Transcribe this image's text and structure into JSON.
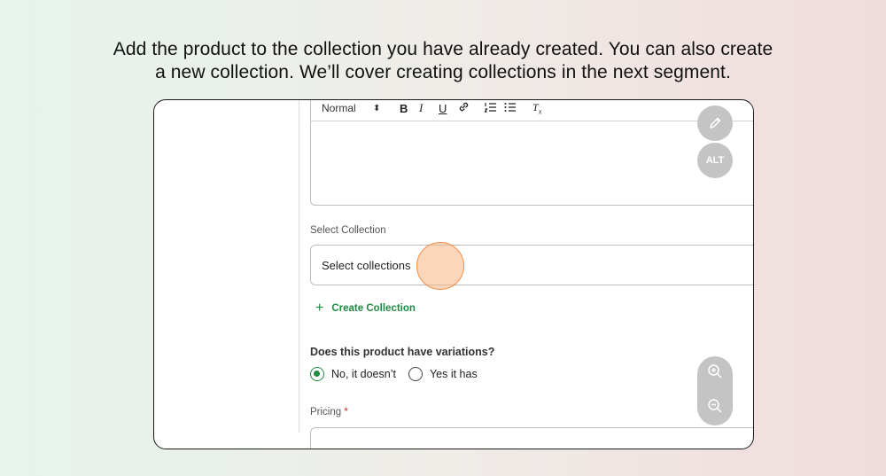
{
  "caption": {
    "line1": "Add the product to the collection you have already created. You can also create",
    "line2": "a new collection. We’ll cover creating collections in the next segment."
  },
  "toolbar": {
    "style_select": "Normal",
    "style_arrows": "⬍",
    "bold": "B",
    "italic": "I",
    "underline": "U",
    "clear_format": "Tx"
  },
  "fab": {
    "alt_label": "ALT"
  },
  "collection": {
    "label": "Select Collection",
    "placeholder": "Select collections",
    "create_label": "Create Collection",
    "create_icon": "+"
  },
  "variations": {
    "question": "Does this product have variations?",
    "option_no": "No, it doesn’t",
    "option_yes": "Yes it has",
    "selected": "No, it doesn’t"
  },
  "pricing": {
    "label": "Pricing",
    "required_mark": "*"
  },
  "colors": {
    "accent_green": "#1e8a44",
    "cursor_highlight": "#f08d45",
    "fab_gray": "#c4c4c4"
  },
  "icons": [
    "link-icon",
    "ordered-list-icon",
    "bullet-list-icon",
    "clear-format-icon",
    "pencil-icon",
    "zoom-in-icon",
    "zoom-out-icon"
  ]
}
